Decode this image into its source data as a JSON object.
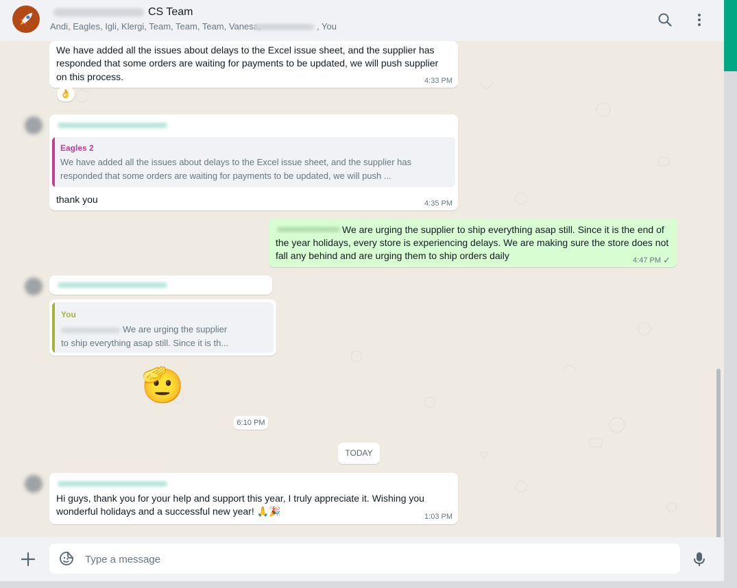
{
  "colors": {
    "accent": "#00a884",
    "outgoing_bubble": "#d9fdd3",
    "incoming_bubble": "#ffffff",
    "quote_author_eagles": "#c13d96",
    "quote_author_you": "#a5b337"
  },
  "header": {
    "title_prefix_blurred": "",
    "title": "CS Team",
    "members": "Andi, Eagles, Igli, Klergi, Team, Team, Team, Vanesa,",
    "members_you": ", You",
    "search_icon": "search-icon",
    "menu_icon": "kebab-menu-icon"
  },
  "messages": {
    "m1": {
      "text_l1": "We have added all the issues about delays to the Excel issue sheet, and the supplier has",
      "text_l2": "responded that some orders are waiting for payments to be updated, we will push supplier",
      "text_l3": "on this process.",
      "time": "4:33 PM",
      "reaction": "👌"
    },
    "m2": {
      "quote_author": "Eagles 2",
      "quote_l1": "We have added all the issues about delays to the Excel issue sheet, and the supplier has",
      "quote_l2": "responded that some orders are waiting for payments to be updated, we will push ...",
      "text": "thank you",
      "time": "4:35 PM"
    },
    "m3": {
      "text_l1": "We are urging the supplier to ship everything asap still. Since it is the end of",
      "text_l2": "the year holidays, every store is experiencing delays. We are making sure the store does not",
      "text_l3": "fall any behind and are urging them to ship orders daily",
      "time": "4:47 PM",
      "status": "✓"
    },
    "m4": {
      "quote_author": "You",
      "quote_l1": "We are urging the supplier",
      "quote_l2": "to ship everything asap still. Since it is th...",
      "sticker": "🫡",
      "time": "6:10 PM"
    },
    "date_divider": "TODAY",
    "m5": {
      "text_l1": "Hi guys, thank you for your help and support this year, I truly appreciate it. Wishing you",
      "text_l2": "wonderful holidays and a successful new year! 🙏🎉",
      "time": "1:03 PM"
    }
  },
  "composer": {
    "placeholder": "Type a message",
    "value": "",
    "attach_icon": "plus-icon",
    "emoji_icon": "sticker-smiley-icon",
    "mic_icon": "microphone-icon"
  }
}
